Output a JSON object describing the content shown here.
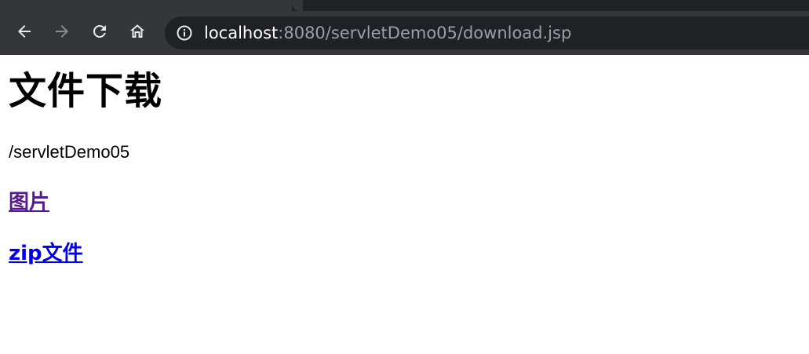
{
  "browser": {
    "url": {
      "host": "localhost",
      "rest": ":8080/servletDemo05/download.jsp"
    },
    "icons": {
      "back": "arrow-left-icon",
      "forward": "arrow-right-icon",
      "reload": "reload-icon",
      "home": "home-icon",
      "site_info": "info-icon"
    },
    "colors": {
      "toolbar": "#35363a",
      "tabstrip": "#202124",
      "omnibox": "#202124",
      "url_host": "#ffffff",
      "url_path": "#9aa0a6"
    }
  },
  "page": {
    "title": "文件下载",
    "context_path": "/servletDemo05",
    "links": [
      {
        "label": "图片",
        "state": "visited",
        "color": "#551a8b"
      },
      {
        "label": "zip文件",
        "state": "unvisited",
        "color": "#0000ee"
      }
    ]
  }
}
